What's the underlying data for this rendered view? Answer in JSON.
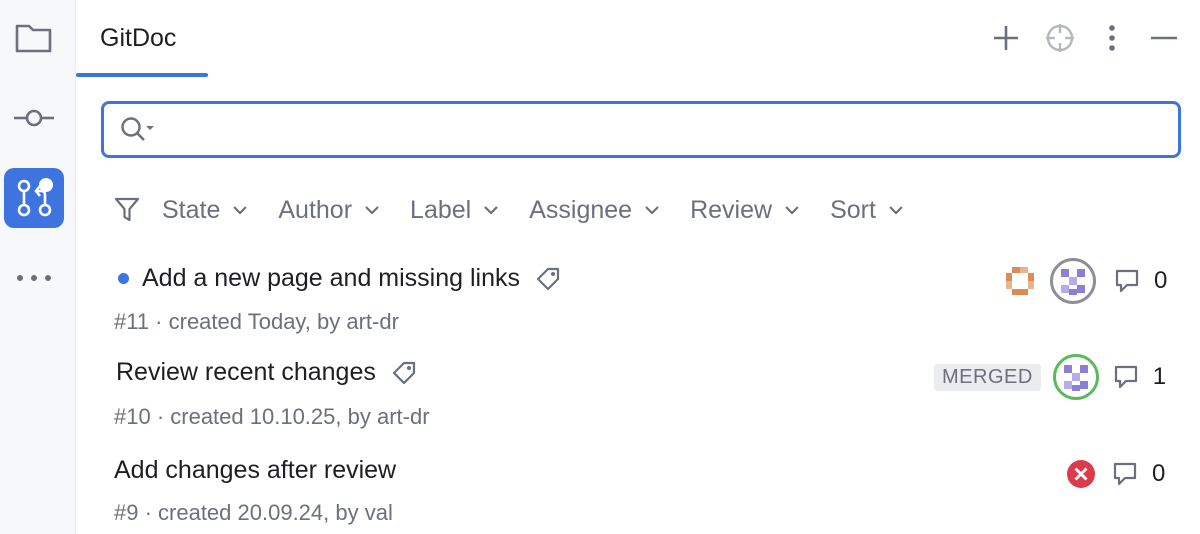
{
  "sidebar": {
    "items": [
      {
        "icon": "folder-icon",
        "active": false
      },
      {
        "icon": "commit-icon",
        "active": false
      },
      {
        "icon": "pull-request-icon",
        "active": true
      },
      {
        "icon": "more-horizontal-icon",
        "active": false
      }
    ]
  },
  "header": {
    "tab_label": "GitDoc",
    "actions": [
      "plus-icon",
      "target-icon",
      "more-vertical-icon",
      "minimize-icon"
    ]
  },
  "search": {
    "value": "",
    "placeholder": ""
  },
  "filters": {
    "items": [
      {
        "label": "State"
      },
      {
        "label": "Author"
      },
      {
        "label": "Label"
      },
      {
        "label": "Assignee"
      },
      {
        "label": "Review"
      },
      {
        "label": "Sort"
      }
    ]
  },
  "pull_requests": [
    {
      "title": "Add a new page and missing links",
      "meta": "#11 · created Today, by art-dr",
      "unread": true,
      "has_label": true,
      "comments": "0"
    },
    {
      "title": "Review recent changes",
      "meta": "#10 · created 10.10.25, by art-dr",
      "unread": false,
      "has_label": true,
      "status": "MERGED",
      "comments": "1"
    },
    {
      "title": "Add changes after review",
      "meta": "#9 · created 20.09.24, by val",
      "unread": false,
      "has_label": false,
      "status_icon": "error-icon",
      "comments": "0"
    }
  ],
  "colors": {
    "accent": "#3d74e0",
    "error": "#db3b4b",
    "merged_badge_bg": "#ebecf0",
    "avatar_green": "#5fb85c"
  }
}
